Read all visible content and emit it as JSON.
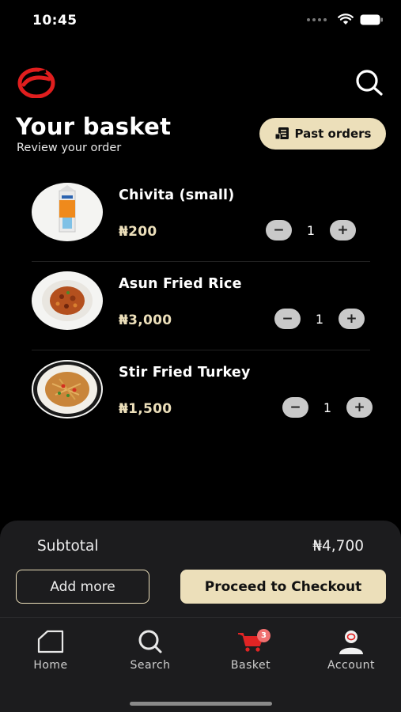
{
  "status": {
    "time": "10:45"
  },
  "header": {
    "title": "Your basket",
    "subtitle": "Review your order",
    "past_orders_label": "Past orders"
  },
  "items": [
    {
      "name": "Chivita (small)",
      "price": "₦200",
      "quantity": "1",
      "icon": "juice-carton-image"
    },
    {
      "name": "Asun Fried Rice",
      "price": "₦3,000",
      "quantity": "1",
      "icon": "fried-rice-plate-image"
    },
    {
      "name": "Stir Fried Turkey",
      "price": "₦1,500",
      "quantity": "1",
      "icon": "stir-fry-plate-image"
    }
  ],
  "summary": {
    "subtotal_label": "Subtotal",
    "subtotal_value": "₦4,700",
    "add_more_label": "Add more",
    "checkout_label": "Proceed to Checkout"
  },
  "tabs": [
    {
      "label": "Home",
      "icon": "home-icon"
    },
    {
      "label": "Search",
      "icon": "search-icon"
    },
    {
      "label": "Basket",
      "icon": "basket-icon",
      "badge": "3"
    },
    {
      "label": "Account",
      "icon": "account-icon"
    }
  ],
  "colors": {
    "accent": "#ecdfba",
    "brand_red": "#e01e1e",
    "background": "#000000",
    "panel": "#1c1c1e"
  }
}
